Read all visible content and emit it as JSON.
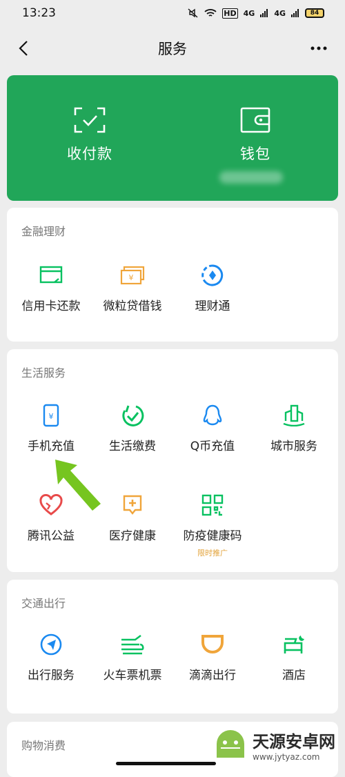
{
  "status": {
    "time": "13:23",
    "battery": "84",
    "signal1": "4G",
    "signal2": "4G",
    "hd": "HD"
  },
  "nav": {
    "title": "服务"
  },
  "hero": {
    "items": [
      "收付款",
      "钱包"
    ]
  },
  "sections": {
    "finance": {
      "title": "金融理财",
      "items": [
        "信用卡还款",
        "微粒贷借钱",
        "理财通"
      ]
    },
    "life": {
      "title": "生活服务",
      "items": [
        "手机充值",
        "生活缴费",
        "Q币充值",
        "城市服务",
        "腾讯公益",
        "医疗健康",
        "防疫健康码"
      ],
      "badge": "限时推广"
    },
    "transport": {
      "title": "交通出行",
      "items": [
        "出行服务",
        "火车票机票",
        "滴滴出行",
        "酒店"
      ]
    },
    "shopping": {
      "title": "购物消费"
    }
  },
  "watermark": {
    "name": "天源安卓网",
    "url": "www.jytyaz.com"
  },
  "colors": {
    "brand_green": "#21a659",
    "icon_green": "#07c160",
    "icon_blue": "#1a89f0",
    "icon_orange": "#f0a53a",
    "icon_red": "#e84a4a",
    "arrow_green": "#76c520"
  }
}
